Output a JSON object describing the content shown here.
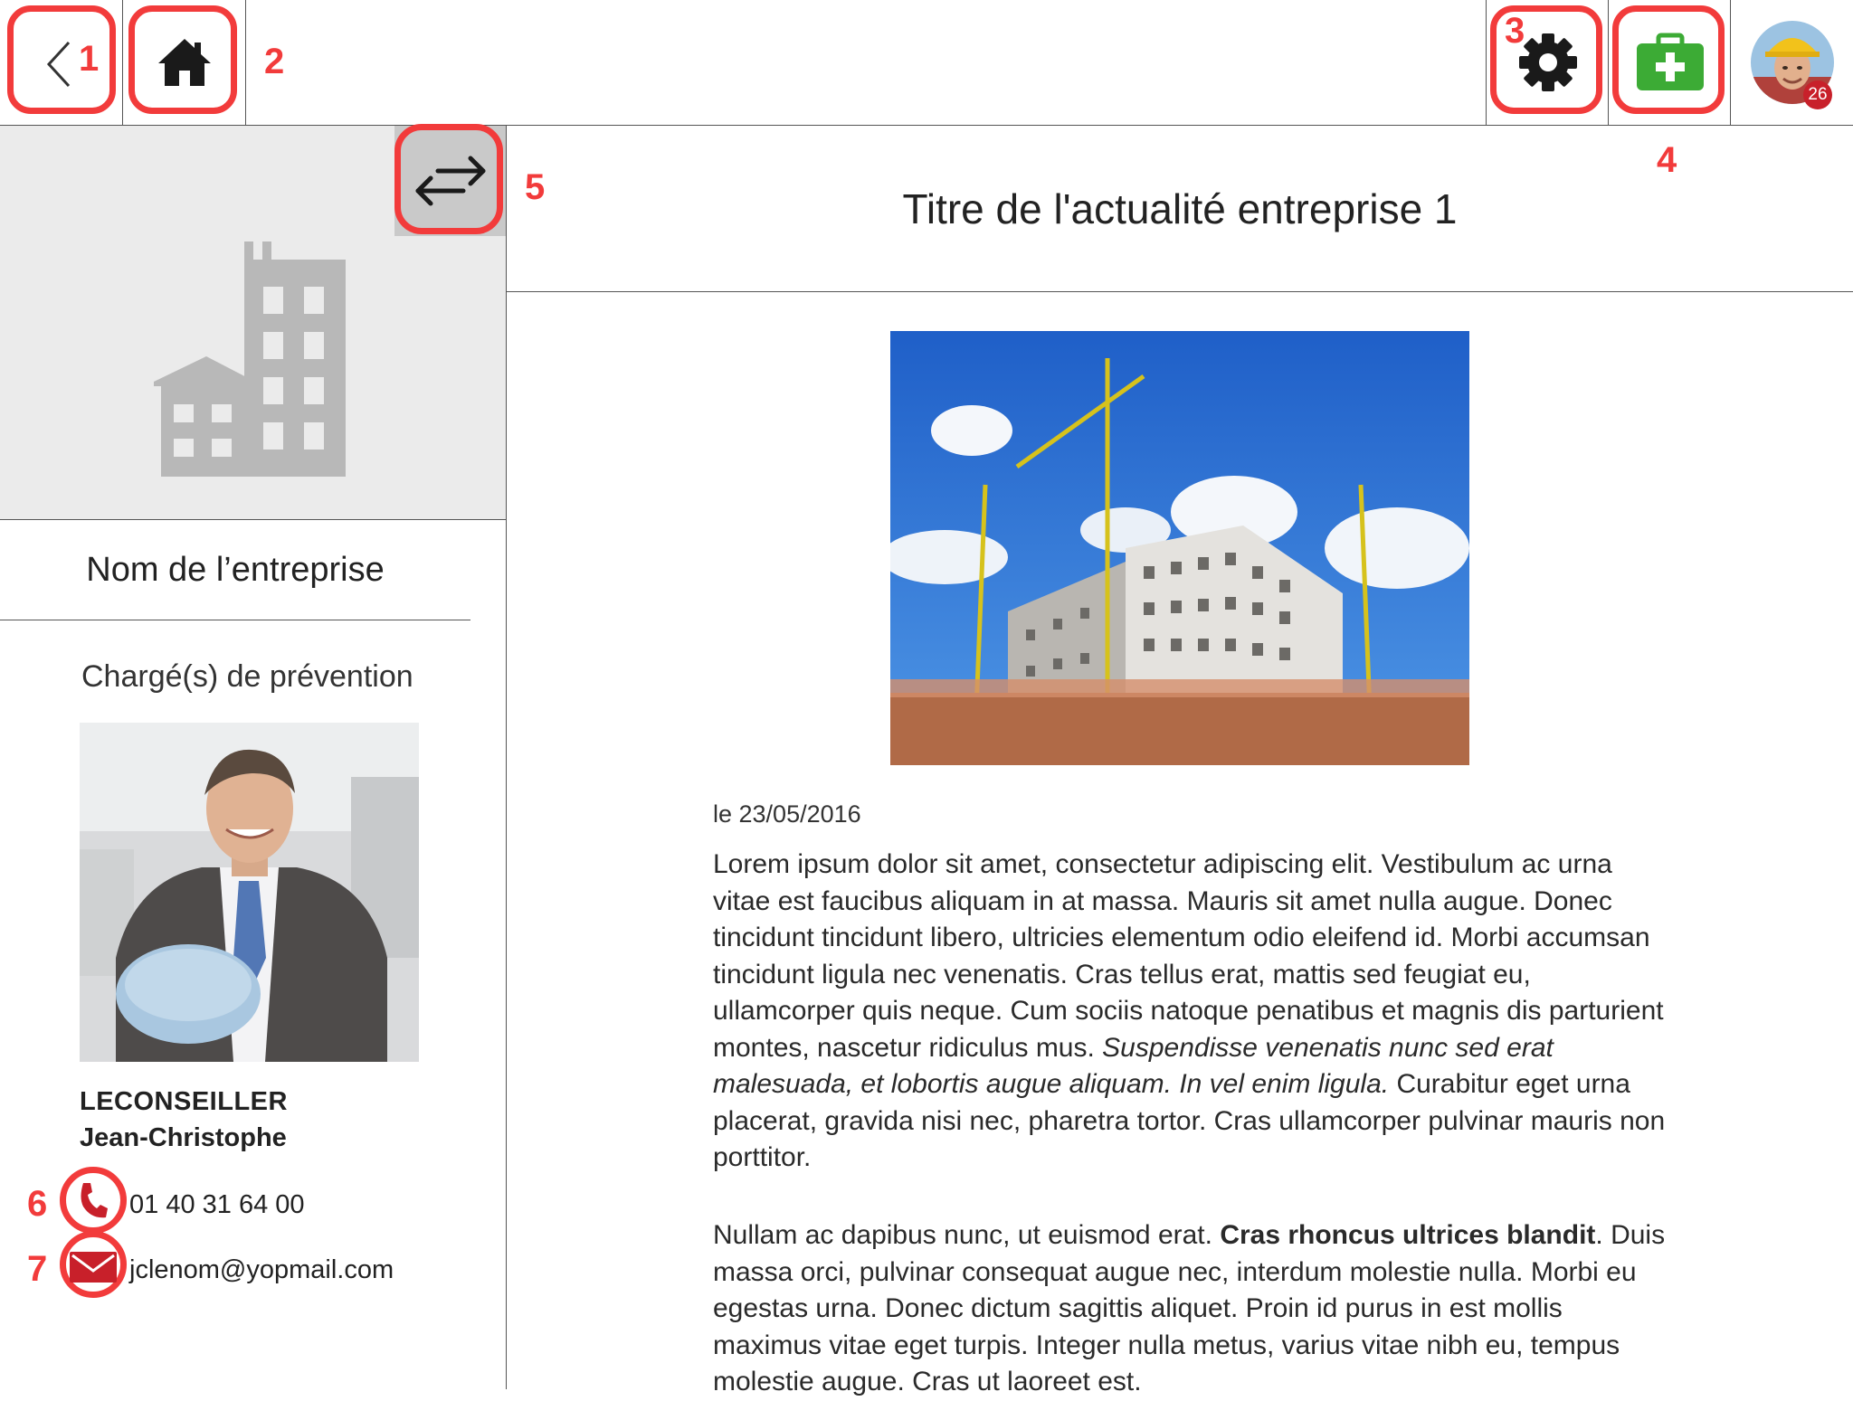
{
  "topbar": {
    "back_marker": "1",
    "home_marker": "2",
    "settings_marker": "3",
    "firstaid_marker": "4",
    "notification_count": "26"
  },
  "sidebar": {
    "swap_marker": "5",
    "company_name": "Nom de l’entreprise",
    "prevention_title": "Chargé(s) de prévention",
    "advisor_lastname": "LECONSEILLER",
    "advisor_firstname": "Jean-Christophe",
    "phone_marker": "6",
    "phone": "01 40 31 64 00",
    "email_marker": "7",
    "email": "jclenom@yopmail.com"
  },
  "article": {
    "title": "Titre de l'actualité entreprise 1",
    "date": "le 23/05/2016",
    "p1_a": "Lorem ipsum dolor sit amet, consectetur adipiscing elit. Vestibulum ac urna vitae est faucibus aliquam in at massa. Mauris sit amet nulla augue. Donec tincidunt tincidunt libero, ultricies elementum odio eleifend id. Morbi accumsan tincidunt ligula nec venenatis. Cras tellus erat, mattis sed feugiat eu, ullamcorper quis neque. Cum sociis natoque penatibus et magnis dis parturient montes, nascetur ridiculus mus. ",
    "p1_italic": "Suspendisse venenatis nunc sed erat malesuada, et lobortis augue aliquam. In vel enim ligula.",
    "p1_b": " Curabitur eget urna placerat, gravida nisi nec, pharetra tortor. Cras ullamcorper pulvinar mauris non porttitor.",
    "p2_a": "Nullam ac dapibus nunc, ut euismod erat. ",
    "p2_bold": "Cras rhoncus ultrices blandit",
    "p2_b": ". Duis massa orci, pulvinar consequat augue nec, interdum molestie nulla. Morbi eu egestas urna. Donec dictum sagittis aliquet. Proin id purus in est mollis maximus vitae eget turpis. Integer nulla metus, varius vitae nibh eu, tempus molestie augue. Cras ut laoreet est."
  },
  "colors": {
    "annotation_red": "#f23b3b",
    "firstaid_green": "#3cab35",
    "contact_red": "#c8202a",
    "placeholder_gray": "#b8b8b8"
  }
}
